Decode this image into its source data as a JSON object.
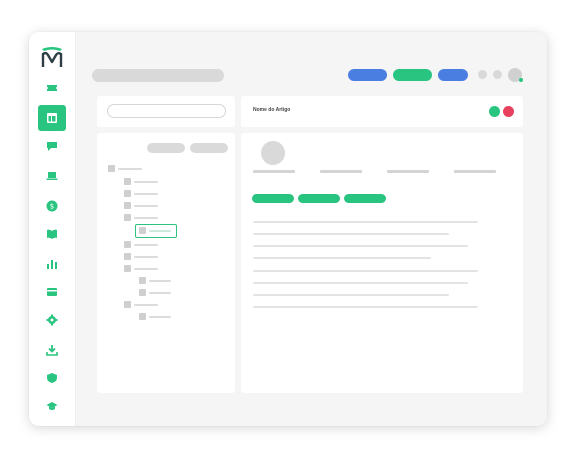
{
  "app": {
    "brand_color": "#29c47f",
    "logo_icon": "lion-m-logo-icon"
  },
  "sidebar": {
    "items": [
      {
        "name": "ticket",
        "icon": "ticket-icon",
        "active": false
      },
      {
        "name": "knowledge-base",
        "icon": "layout-icon",
        "active": true
      },
      {
        "name": "chat",
        "icon": "chat-icon",
        "active": false
      },
      {
        "name": "computer",
        "icon": "laptop-icon",
        "active": false
      },
      {
        "name": "billing",
        "icon": "dollar-icon",
        "active": false
      },
      {
        "name": "docs",
        "icon": "book-icon",
        "active": false
      },
      {
        "name": "reports",
        "icon": "bar-chart-icon",
        "active": false
      },
      {
        "name": "cards",
        "icon": "card-icon",
        "active": false
      },
      {
        "name": "settings",
        "icon": "gear-icon",
        "active": false
      },
      {
        "name": "download",
        "icon": "download-icon",
        "active": false
      },
      {
        "name": "security",
        "icon": "shield-icon",
        "active": false
      },
      {
        "name": "learning",
        "icon": "graduation-cap-icon",
        "active": false
      }
    ]
  },
  "header": {
    "button_colors": [
      "#4a7ee0",
      "#29c47f",
      "#4a7ee0"
    ]
  },
  "article": {
    "title": "Nome do Artigo",
    "status_colors": [
      "#29c47f",
      "#e8415e"
    ]
  }
}
